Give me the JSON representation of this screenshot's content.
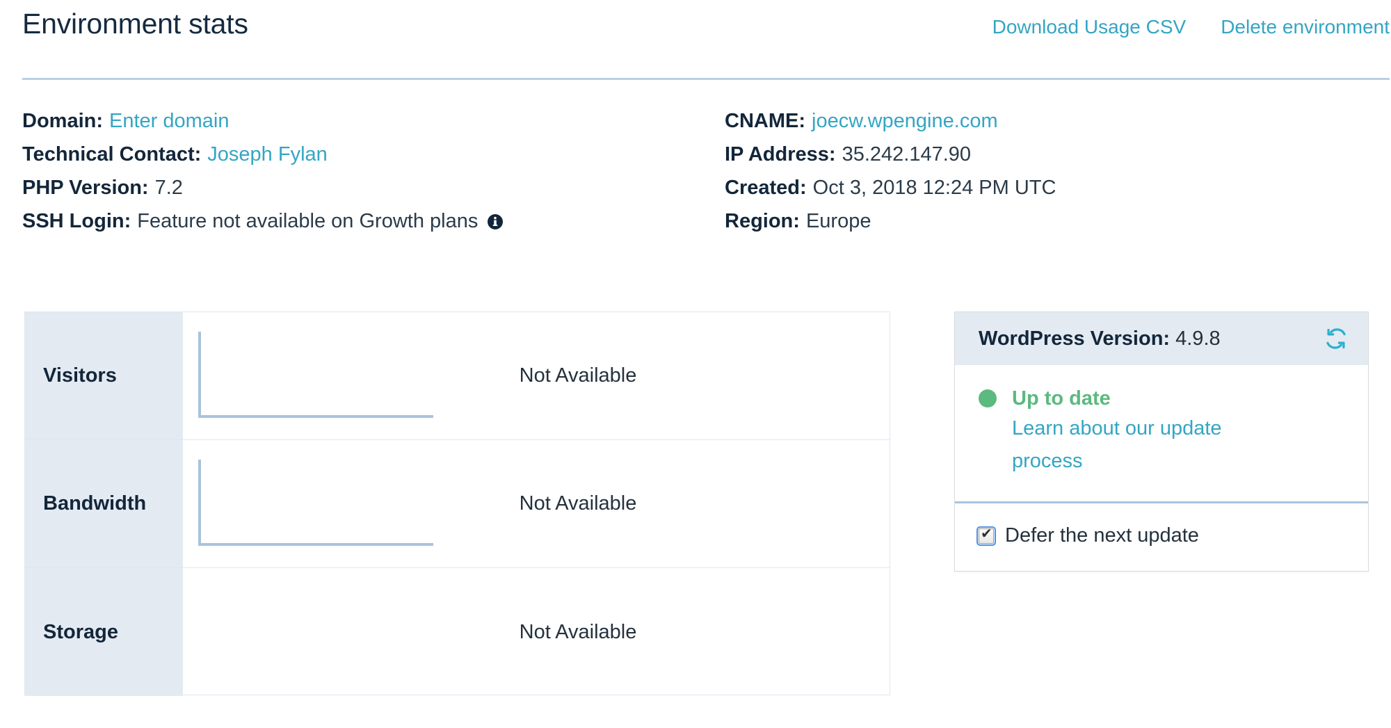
{
  "header": {
    "title": "Environment stats",
    "actions": [
      {
        "label": "Download Usage CSV",
        "name": "download-usage-csv-link"
      },
      {
        "label": "Delete environment",
        "name": "delete-environment-link"
      }
    ]
  },
  "meta": {
    "left": [
      {
        "label": "Domain:",
        "value": "Enter domain",
        "is_link": true
      },
      {
        "label": "Technical Contact:",
        "value": "Joseph Fylan",
        "is_link": true
      },
      {
        "label": "PHP Version:",
        "value": "7.2",
        "is_link": false
      },
      {
        "label": "SSH Login:",
        "value": "Feature not available on Growth plans",
        "is_link": false,
        "info_icon": "info-icon"
      }
    ],
    "right": [
      {
        "label": "CNAME:",
        "value": "joecw.wpengine.com",
        "is_link": true
      },
      {
        "label": "IP Address:",
        "value": "35.242.147.90",
        "is_link": false
      },
      {
        "label": "Created:",
        "value": "Oct 3, 2018 12:24 PM UTC",
        "is_link": false
      },
      {
        "label": "Region:",
        "value": "Europe",
        "is_link": false
      }
    ]
  },
  "stats": {
    "rows": [
      {
        "label": "Visitors",
        "value": "Not Available",
        "has_chart": true
      },
      {
        "label": "Bandwidth",
        "value": "Not Available",
        "has_chart": true
      },
      {
        "label": "Storage",
        "value": "Not Available",
        "has_chart": false
      }
    ]
  },
  "wordpress_card": {
    "version_label": "WordPress Version:",
    "version_value": "4.9.8",
    "refresh_icon": "refresh-icon",
    "status_title": "Up to date",
    "status_dot_color": "#5cb97f",
    "status_link": "Learn about our update process",
    "defer_checkbox_label": "Defer the next update",
    "defer_checkbox_checked": true
  },
  "colors": {
    "accent_link": "#34a5c3",
    "heading": "#13263a",
    "status_green": "#5cb97f",
    "panel_bg": "#e3eaf2",
    "divider": "#b9cfe6",
    "axis": "#a9c3dd"
  },
  "chart_data": [
    {
      "type": "line",
      "title": "Visitors",
      "series": [
        {
          "name": "Visitors",
          "values": []
        }
      ],
      "x": [],
      "categories": [],
      "xlabel": "",
      "ylabel": "",
      "annotations": [
        "Not Available"
      ],
      "grid": false,
      "legend": "none"
    },
    {
      "type": "line",
      "title": "Bandwidth",
      "series": [
        {
          "name": "Bandwidth",
          "values": []
        }
      ],
      "x": [],
      "categories": [],
      "xlabel": "",
      "ylabel": "",
      "annotations": [
        "Not Available"
      ],
      "grid": false,
      "legend": "none"
    },
    {
      "type": "line",
      "title": "Storage",
      "series": [
        {
          "name": "Storage",
          "values": []
        }
      ],
      "x": [],
      "categories": [],
      "xlabel": "",
      "ylabel": "",
      "annotations": [
        "Not Available"
      ],
      "grid": false,
      "legend": "none"
    }
  ]
}
